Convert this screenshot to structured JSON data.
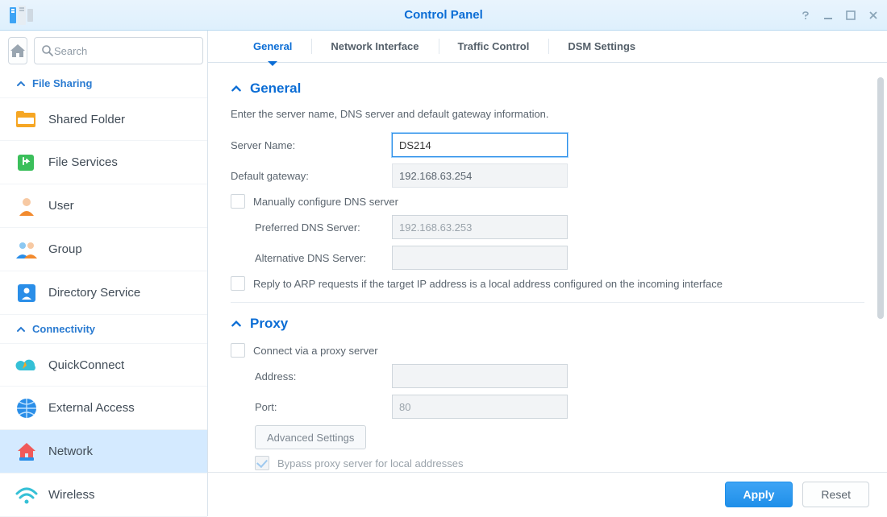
{
  "titlebar": {
    "title": "Control Panel"
  },
  "search": {
    "placeholder": "Search"
  },
  "sidebar": {
    "sections": [
      {
        "label": "File Sharing",
        "items": [
          {
            "label": "Shared Folder"
          },
          {
            "label": "File Services"
          },
          {
            "label": "User"
          },
          {
            "label": "Group"
          },
          {
            "label": "Directory Service"
          }
        ]
      },
      {
        "label": "Connectivity",
        "items": [
          {
            "label": "QuickConnect"
          },
          {
            "label": "External Access"
          },
          {
            "label": "Network"
          },
          {
            "label": "Wireless"
          }
        ]
      }
    ]
  },
  "tabs": [
    {
      "label": "General"
    },
    {
      "label": "Network Interface"
    },
    {
      "label": "Traffic Control"
    },
    {
      "label": "DSM Settings"
    }
  ],
  "general": {
    "heading": "General",
    "description": "Enter the server name, DNS server and default gateway information.",
    "server_name_label": "Server Name:",
    "server_name_value": "DS214",
    "default_gateway_label": "Default gateway:",
    "default_gateway_value": "192.168.63.254",
    "manual_dns_label": "Manually configure DNS server",
    "preferred_dns_label": "Preferred DNS Server:",
    "preferred_dns_value": "192.168.63.253",
    "alt_dns_label": "Alternative DNS Server:",
    "alt_dns_value": "",
    "arp_label": "Reply to ARP requests if the target IP address is a local address configured on the incoming interface"
  },
  "proxy": {
    "heading": "Proxy",
    "connect_label": "Connect via a proxy server",
    "address_label": "Address:",
    "address_value": "",
    "port_label": "Port:",
    "port_value": "80",
    "advanced_label": "Advanced Settings",
    "bypass_label": "Bypass proxy server for local addresses"
  },
  "footer": {
    "apply": "Apply",
    "reset": "Reset"
  }
}
